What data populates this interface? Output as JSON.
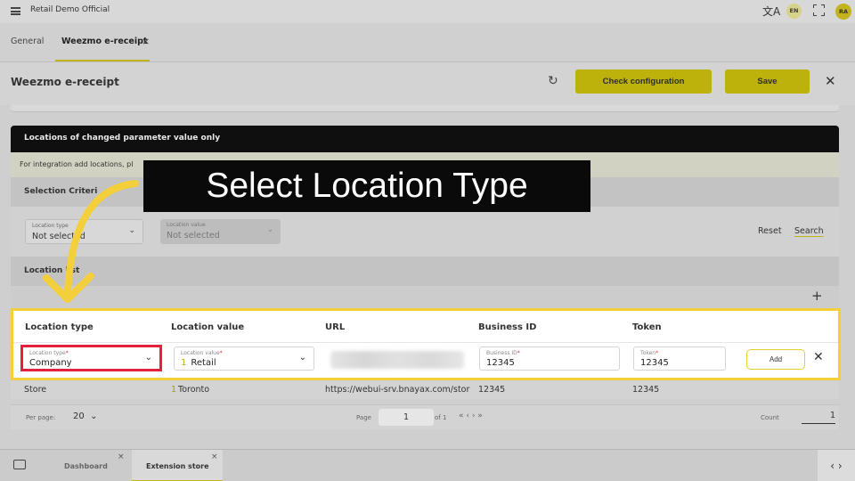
{
  "app": {
    "title": "Retail Demo Official",
    "lang": "EN",
    "user_initials": "RA"
  },
  "tabs": [
    {
      "label": "General"
    },
    {
      "label": "Weezmo e-receipt",
      "close": "×"
    }
  ],
  "page": {
    "title": "Weezmo e-receipt",
    "check_config_label": "Check configuration",
    "save_label": "Save"
  },
  "section": {
    "header": "Locations of changed parameter value only",
    "info": "For integration add locations, pl",
    "criteria_label": "Selection Criteri",
    "filter_type": {
      "label": "Location type",
      "value": "Not selected"
    },
    "filter_value": {
      "label": "Location value",
      "value": "Not selected"
    },
    "reset_label": "Reset",
    "search_label": "Search",
    "list_label": "Location list"
  },
  "table": {
    "columns": [
      "Location type",
      "Location value",
      "URL",
      "Business ID",
      "Token"
    ],
    "new_row": {
      "type_label": "Location type",
      "type_value": "Company",
      "value_label": "Location value",
      "value_num": "1",
      "value_text": "Retail",
      "business_label": "Business ID",
      "business_value": "12345",
      "token_label": "Token",
      "token_value": "12345",
      "add_label": "Add"
    },
    "rows": [
      {
        "type": "Store",
        "value_num": "1",
        "value_text": "Toronto",
        "url": "https://webui-srv.bnayax.com/stor",
        "business_id": "12345",
        "token": "12345"
      }
    ]
  },
  "pager": {
    "per_page_label": "Per page:",
    "per_page": "20",
    "page_label": "Page",
    "page": "1",
    "of": "of 1",
    "nav": "«  ‹  ›  »",
    "count_label": "Count",
    "count": "1"
  },
  "bottom_tabs": [
    {
      "label": "Dashboard"
    },
    {
      "label": "Extension store"
    }
  ],
  "tooltip": {
    "text": "Select Location Type"
  },
  "colors": {
    "accent": "#f4cf3c",
    "highlight_red": "#e5203d",
    "button_yellow": "#e8db0b"
  }
}
